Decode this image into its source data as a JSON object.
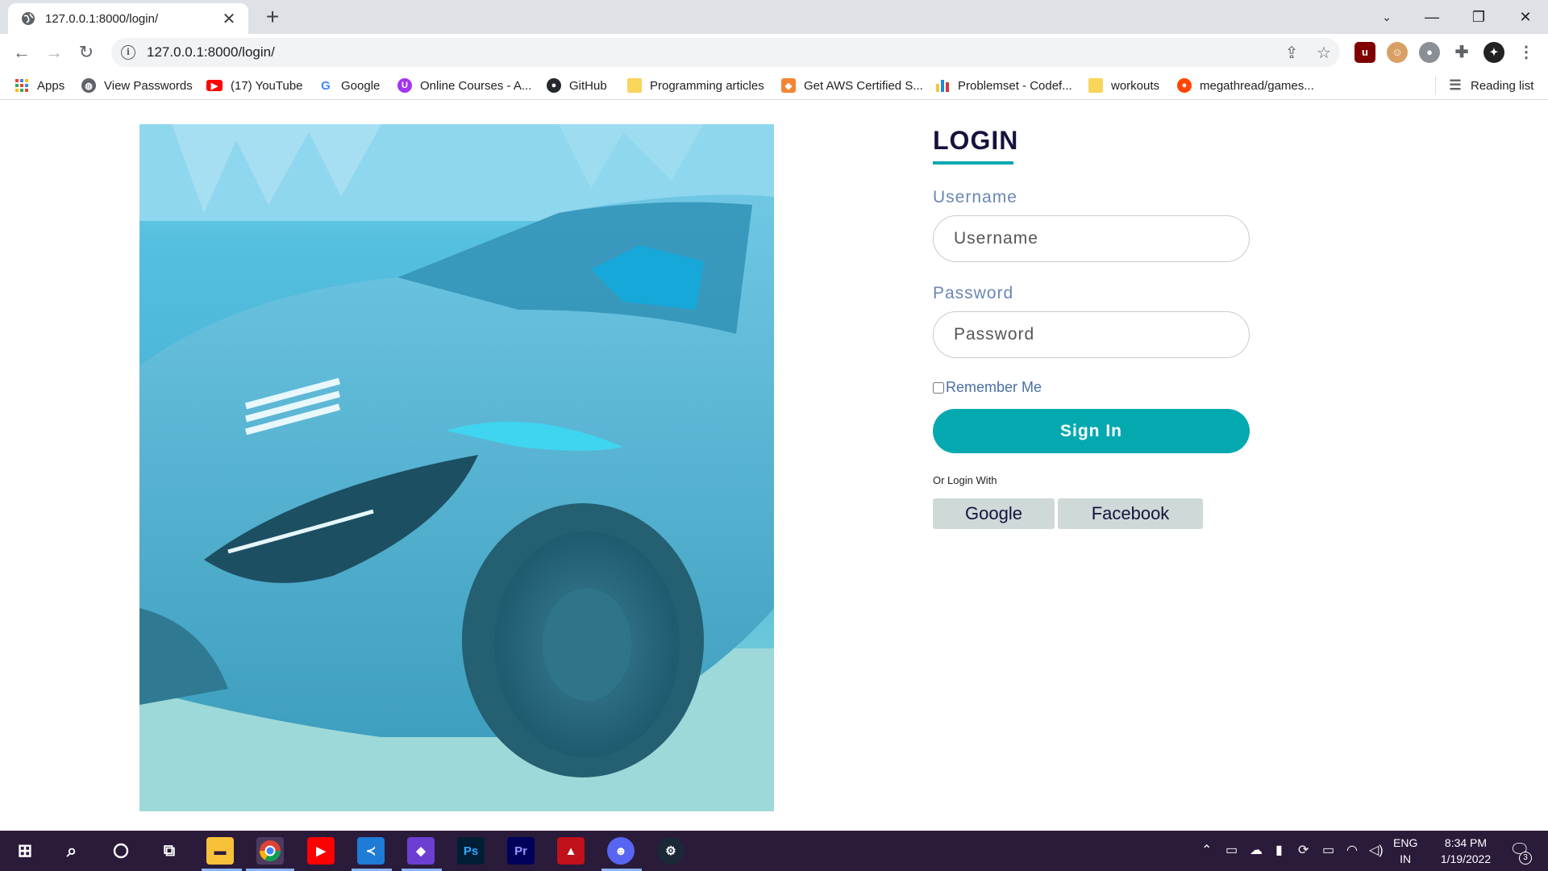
{
  "browser": {
    "tab_title": "127.0.0.1:8000/login/",
    "url": "127.0.0.1:8000/login/",
    "bookmarks": [
      {
        "label": "Apps",
        "icon": "apps-grid-icon"
      },
      {
        "label": "View Passwords",
        "icon": "globe-icon"
      },
      {
        "label": "(17) YouTube",
        "icon": "youtube-icon"
      },
      {
        "label": "Google",
        "icon": "google-icon"
      },
      {
        "label": "Online Courses - A...",
        "icon": "udemy-icon"
      },
      {
        "label": "GitHub",
        "icon": "github-icon"
      },
      {
        "label": "Programming articles",
        "icon": "folder-icon"
      },
      {
        "label": "Get AWS Certified S...",
        "icon": "cube-icon"
      },
      {
        "label": "Problemset - Codef...",
        "icon": "codeforces-icon"
      },
      {
        "label": "workouts",
        "icon": "folder-icon"
      },
      {
        "label": "megathread/games...",
        "icon": "reddit-icon"
      }
    ],
    "reading_list": "Reading list"
  },
  "login": {
    "title": "LOGIN",
    "username_label": "Username",
    "username_placeholder": "Username",
    "password_label": "Password",
    "password_placeholder": "Password",
    "remember_label": "Remember Me",
    "sign_in": "Sign In",
    "or_login_with": "Or Login With",
    "google": "Google",
    "facebook": "Facebook"
  },
  "taskbar": {
    "lang": "ENG",
    "region": "IN",
    "time": "8:34 PM",
    "date": "1/19/2022",
    "notifications": "3"
  },
  "colors": {
    "accent": "#04a9b0",
    "title": "#15133c",
    "label": "#6b86b5",
    "social_bg": "#cfd9d8",
    "taskbar": "#2a1b3a"
  }
}
